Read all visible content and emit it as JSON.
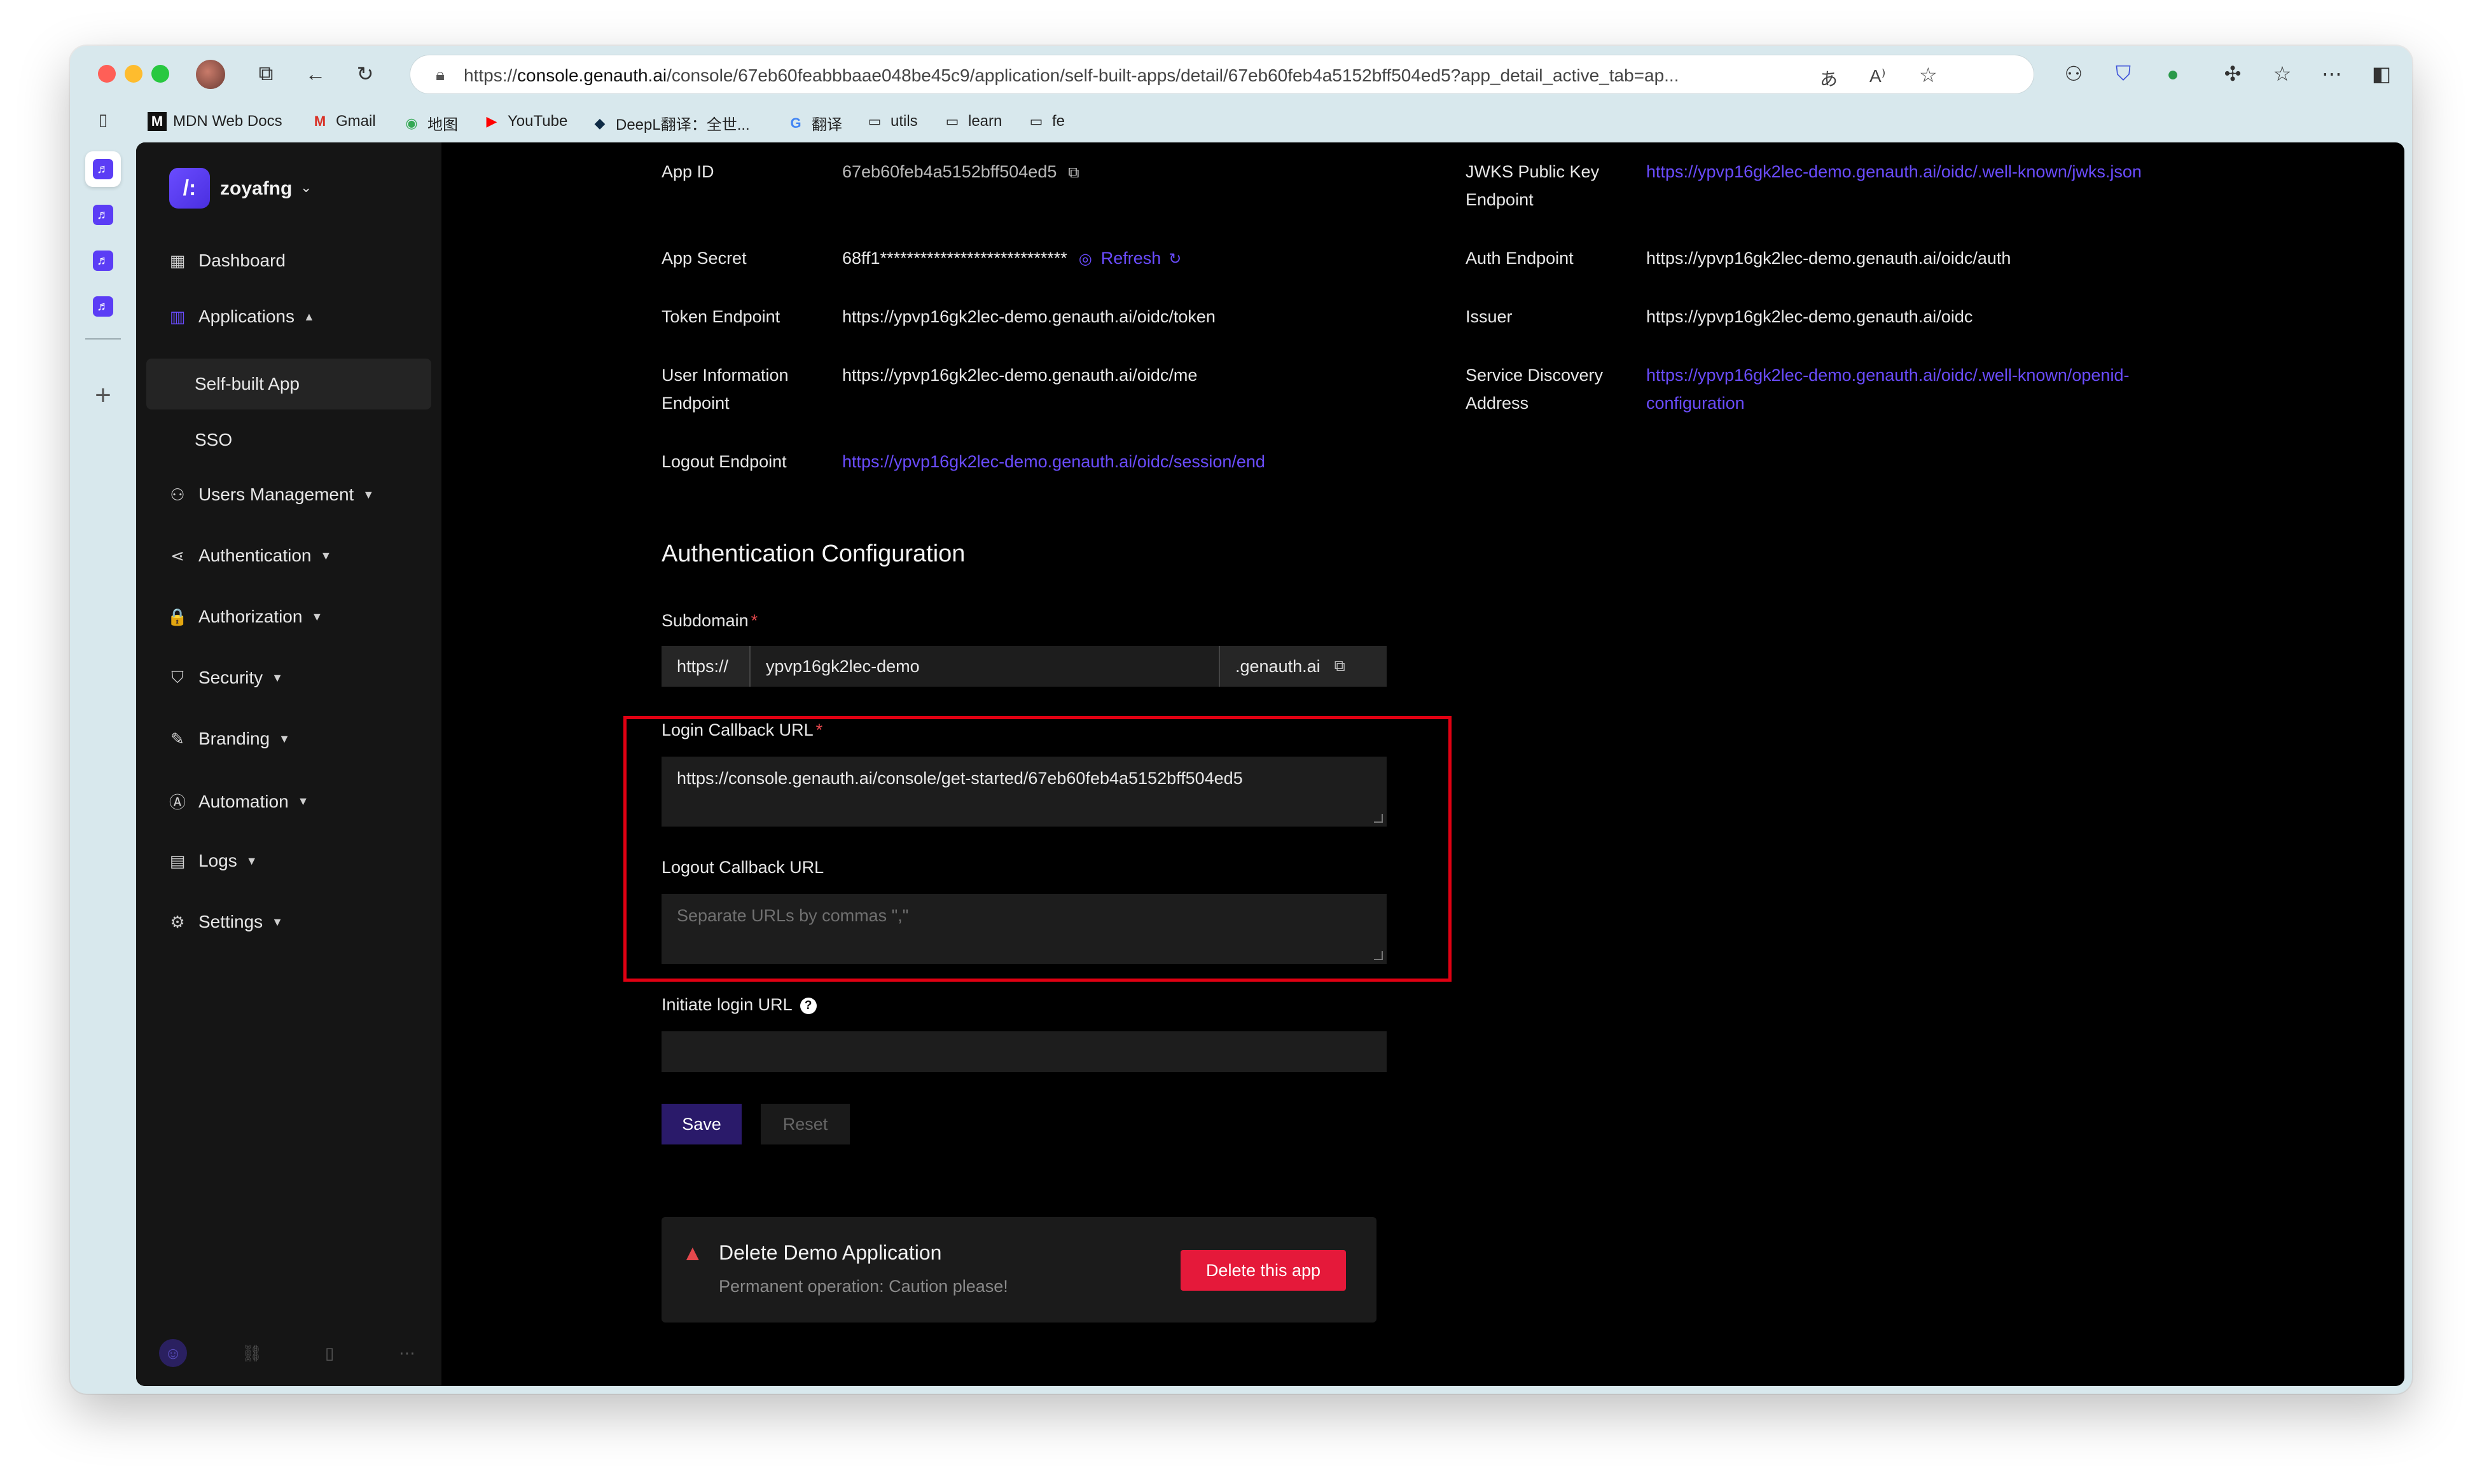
{
  "browser": {
    "url_prefix": "https://",
    "url_host": "console.genauth.ai",
    "url_rest": "/console/67eb60feabbbaae048be45c9/application/self-built-apps/detail/67eb60feb4a5152bff504ed5?app_detail_active_tab=ap...",
    "translate_icon": "translate-icon",
    "read_aloud_icon": "read-aloud-icon"
  },
  "bookmarks": [
    {
      "label": "MDN Web Docs",
      "icon": "M"
    },
    {
      "label": "Gmail",
      "icon": "M"
    },
    {
      "label": "地图",
      "icon": "◉"
    },
    {
      "label": "YouTube",
      "icon": "▶"
    },
    {
      "label": "DeepL翻译：全世...",
      "icon": "◆"
    },
    {
      "label": "翻译",
      "icon": "G"
    },
    {
      "label": "utils",
      "icon": "▭"
    },
    {
      "label": "learn",
      "icon": "▭"
    },
    {
      "label": "fe",
      "icon": "▭"
    }
  ],
  "sidebar": {
    "org_name": "zoyafng",
    "logo_glyph": "/:",
    "items": [
      {
        "label": "Dashboard",
        "icon": "▦"
      },
      {
        "label": "Applications",
        "icon": "▥"
      },
      {
        "label": "Self-built App"
      },
      {
        "label": "SSO"
      },
      {
        "label": "Users Management",
        "icon": "⚇"
      },
      {
        "label": "Authentication",
        "icon": "⋖"
      },
      {
        "label": "Authorization",
        "icon": "🔒"
      },
      {
        "label": "Security",
        "icon": "⛉"
      },
      {
        "label": "Branding",
        "icon": "✎"
      },
      {
        "label": "Automation",
        "icon": "Ⓐ"
      },
      {
        "label": "Logs",
        "icon": "▤"
      },
      {
        "label": "Settings",
        "icon": "⚙"
      }
    ]
  },
  "details": {
    "app_id_label": "App ID",
    "app_id_value": "67eb60feb4a5152bff504ed5",
    "app_secret_label": "App Secret",
    "app_secret_value": "68ff1****************************",
    "refresh_label": "Refresh",
    "token_endpoint_label": "Token Endpoint",
    "token_endpoint_value": "https://ypvp16gk2lec-demo.genauth.ai/oidc/token",
    "user_info_label": "User Information Endpoint",
    "user_info_value": "https://ypvp16gk2lec-demo.genauth.ai/oidc/me",
    "logout_endpoint_label": "Logout Endpoint",
    "logout_endpoint_value": "https://ypvp16gk2lec-demo.genauth.ai/oidc/session/end",
    "jwks_label": "JWKS Public Key Endpoint",
    "jwks_value": "https://ypvp16gk2lec-demo.genauth.ai/oidc/.well-known/jwks.json",
    "auth_endpoint_label": "Auth Endpoint",
    "auth_endpoint_value": "https://ypvp16gk2lec-demo.genauth.ai/oidc/auth",
    "issuer_label": "Issuer",
    "issuer_value": "https://ypvp16gk2lec-demo.genauth.ai/oidc",
    "discovery_label": "Service Discovery Address",
    "discovery_value": "https://ypvp16gk2lec-demo.genauth.ai/oidc/.well-known/openid-configuration"
  },
  "auth_config": {
    "title": "Authentication Configuration",
    "subdomain_label": "Subdomain",
    "subdomain_prefix": "https://",
    "subdomain_value": "ypvp16gk2lec-demo",
    "subdomain_suffix": ".genauth.ai",
    "login_callback_label": "Login Callback URL",
    "login_callback_value": "https://console.genauth.ai/console/get-started/67eb60feb4a5152bff504ed5",
    "logout_callback_label": "Logout Callback URL",
    "logout_callback_placeholder": "Separate URLs by commas \",\"",
    "initiate_login_label": "Initiate login URL",
    "save_label": "Save",
    "reset_label": "Reset"
  },
  "danger_zone": {
    "title": "Delete Demo Application",
    "description": "Permanent operation: Caution please!",
    "delete_label": "Delete this app"
  },
  "colors": {
    "accent": "#6a4cff",
    "danger": "#e5193a",
    "highlight": "#e00012"
  }
}
